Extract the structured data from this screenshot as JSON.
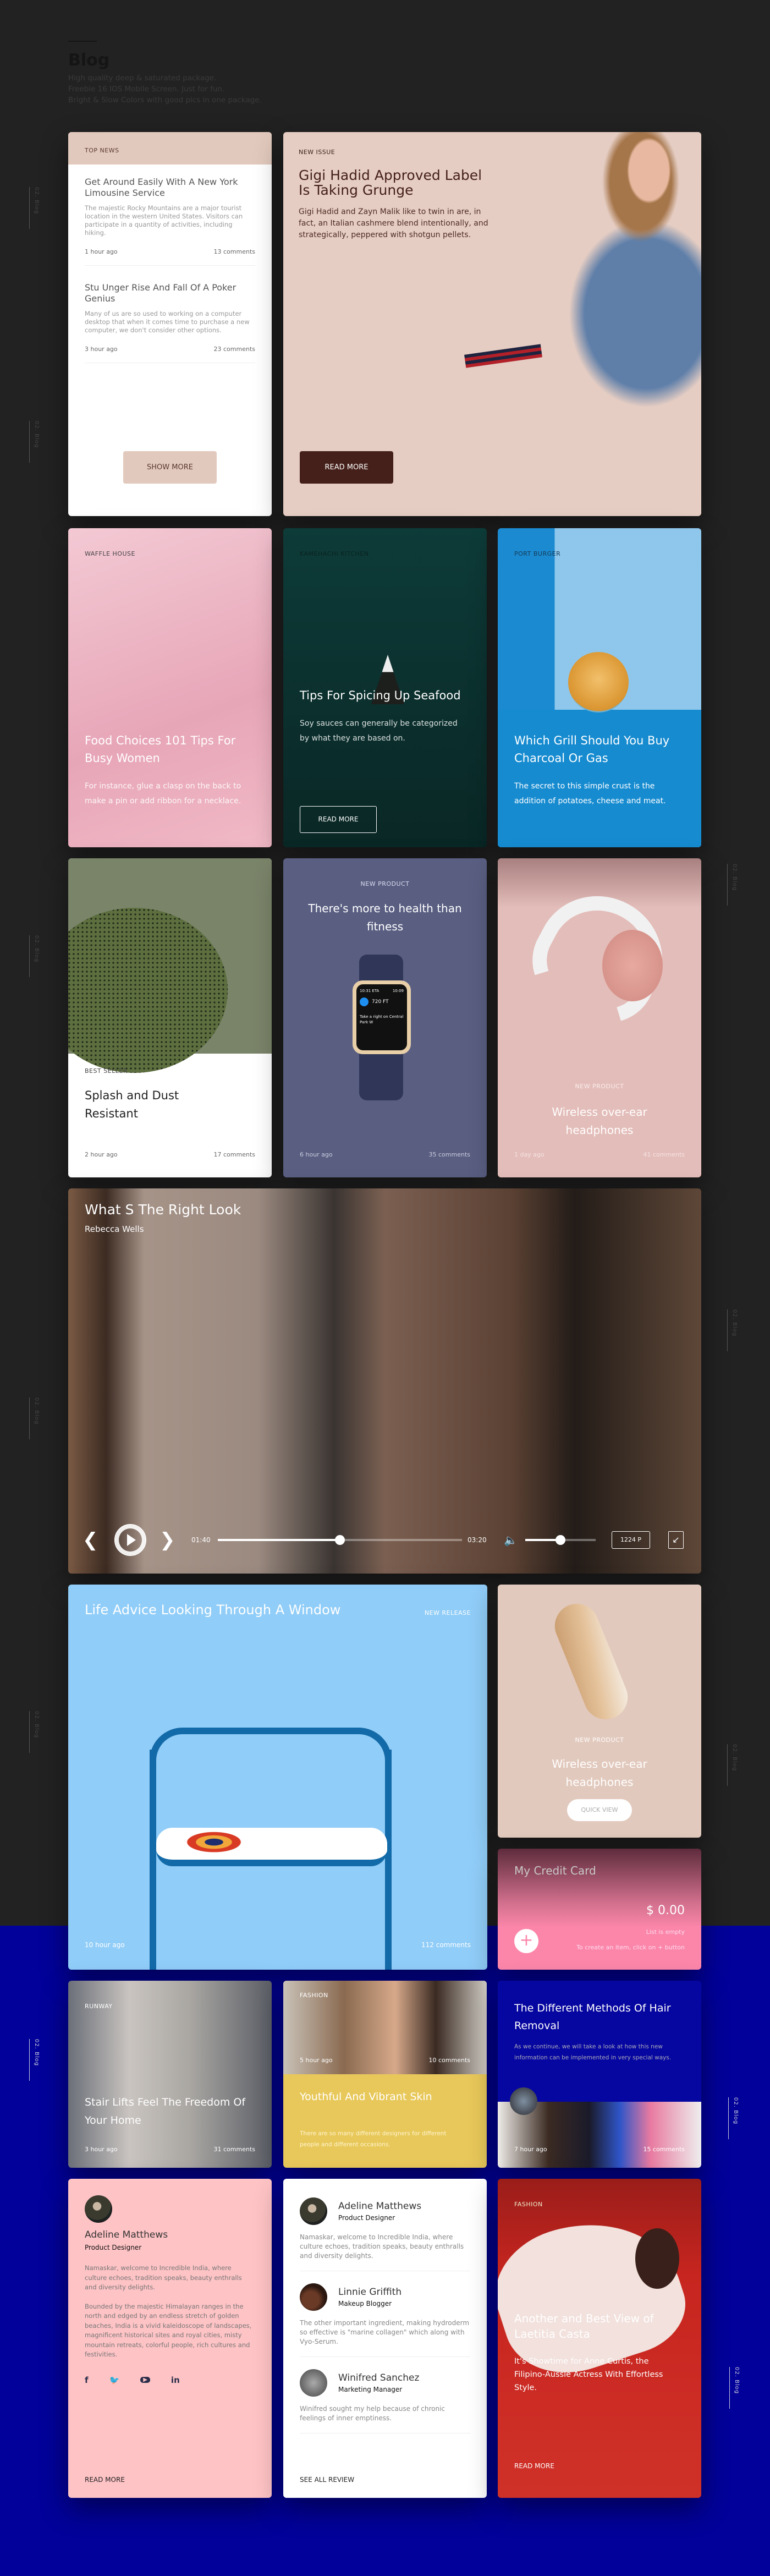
{
  "header": {
    "title": "Blog",
    "subtitle_lines": [
      "High quality deep & saturated package.",
      "Freebie 16 IOS Mobile Screen. Just for fun.",
      "Bright & Slow Colors with good pics in one package."
    ]
  },
  "side_label": "02. Blog",
  "top_news": {
    "tag": "TOP NEWS",
    "items": [
      {
        "title": "Get Around Easily With A New York Limousine Service",
        "text": "The majestic Rocky Mountains are a major tourist location in the western United States. Visitors can participate in a quantity of activities, including hiking.",
        "time": "1 hour ago",
        "comments": "13 comments"
      },
      {
        "title": "Stu Unger Rise And Fall Of A Poker Genius",
        "text": "Many of us are so used to working on a computer desktop that when it comes time to purchase a new computer, we don't consider other options.",
        "time": "3 hour ago",
        "comments": "23 comments"
      }
    ],
    "button": "SHOW MORE"
  },
  "new_issue": {
    "tag": "NEW ISSUE",
    "title": "Gigi Hadid Approved Label Is Taking Grunge",
    "text": "Gigi Hadid and Zayn Malik like to twin in are, in fact, an Italian cashmere blend intentionally, and strategically, peppered with shotgun pellets.",
    "button": "READ MORE"
  },
  "food_cards": [
    {
      "tag": "WAFFLE HOUSE",
      "title": "Food Choices 101 Tips For Busy Women",
      "text": "For instance, glue a clasp on the back to make a pin or add ribbon for a necklace."
    },
    {
      "tag": "KAMEHACHI KITCHEN",
      "title": "Tips For Spicing Up Seafood",
      "text": "Soy sauces can generally be categorized by what they are based on.",
      "button": "READ MORE"
    },
    {
      "tag": "PORT BURGER",
      "title": "Which Grill Should You Buy Charcoal Or Gas",
      "text": "The secret to this simple crust is the addition of potatoes, cheese and meat."
    }
  ],
  "products": [
    {
      "tag": "BEST SELLER",
      "title": "Splash and Dust Resistant",
      "time": "2 hour ago",
      "comments": "17 comments"
    },
    {
      "tag": "NEW PRODUCT",
      "title": "There's more to health than fitness",
      "time": "6 hour ago",
      "comments": "35 comments",
      "watch": {
        "eta": "10:31 ETA",
        "clock": "10:09",
        "distance": "720 FT",
        "instruction": "Take a right on Central Park W"
      }
    },
    {
      "tag": "NEW PRODUCT",
      "title": "Wireless over-ear headphones",
      "time": "1 day ago",
      "comments": "41 comments"
    }
  ],
  "video": {
    "title": "What S The Right Look",
    "author": "Rebecca Wells",
    "current": "01:40",
    "duration": "03:20",
    "progress": 0.5,
    "volume": 0.5,
    "quality": "1224 P"
  },
  "release": {
    "title": "Life Advice Looking Through A Window",
    "tag": "NEW RELEASE",
    "time": "10 hour ago",
    "comments": "112 comments"
  },
  "sneaker": {
    "tag": "NEW PRODUCT",
    "title": "Wireless over-ear headphones",
    "button": "QUICK VIEW"
  },
  "credit": {
    "title": "My Credit Card",
    "amount": "$ 0.00",
    "empty": "List is empty",
    "hint": "To create an item, click on + button"
  },
  "runway": {
    "tag": "RUNWAY",
    "title": "Stair Lifts Feel The Freedom Of Your Home",
    "time": "3 hour ago",
    "comments": "31 comments"
  },
  "fashion_small": {
    "tag": "FASHION",
    "time": "5 hour ago",
    "comments": "10 comments",
    "title": "Youthful And Vibrant Skin",
    "text": "There are so many different designers for different people and different occasions."
  },
  "hair": {
    "title": "The Different Methods Of Hair Removal",
    "text": "As we continue, we will take a look at how this new information can be implemented in very special ways.",
    "time": "7 hour ago",
    "comments": "15 comments"
  },
  "profile": {
    "name": "Adeline Matthews",
    "role": "Product Designer",
    "p1": "Namaskar, welcome to Incredible India, where culture echoes, tradition speaks, beauty enthralls and diversity delights.",
    "p2": "Bounded by the majestic Himalayan ranges in the north and edged by an endless stretch of golden beaches, India is a vivid kaleidoscope of landscapes, magnificent historical sites and royal cities, misty mountain retreats, colorful people, rich cultures and festivities.",
    "social": [
      "f",
      "twitter",
      "youtube",
      "in"
    ],
    "button": "READ MORE"
  },
  "reviews": {
    "items": [
      {
        "name": "Adeline Matthews",
        "role": "Product Designer",
        "text": "Namaskar, welcome to Incredible India, where culture echoes, tradition speaks, beauty enthralls and diversity delights."
      },
      {
        "name": "Linnie Griffith",
        "role": "Makeup Blogger",
        "text": "The other important ingredient, making hydroderm so effective is \"marine collagen\" which along with Vyo-Serum."
      },
      {
        "name": "Winifred Sanchez",
        "role": "Marketing Manager",
        "text": "Winifred sought my help because of chronic feelings of inner emptiness."
      }
    ],
    "button": "SEE ALL REVIEW"
  },
  "casta": {
    "tag": "FASHION",
    "title": "Another and Best View of Laetitia Casta",
    "text": "It's Showtime for Anne Curtis, the Filipino-Aussie Actress With Effortless Style.",
    "button": "READ MORE"
  },
  "colors": {
    "dark_bg": "#222222",
    "blue_bg": "#02029a",
    "peach": "#e2c9bd",
    "brown": "#45201a",
    "yellow": "#e8c85a",
    "pink": "#fb86aa"
  }
}
